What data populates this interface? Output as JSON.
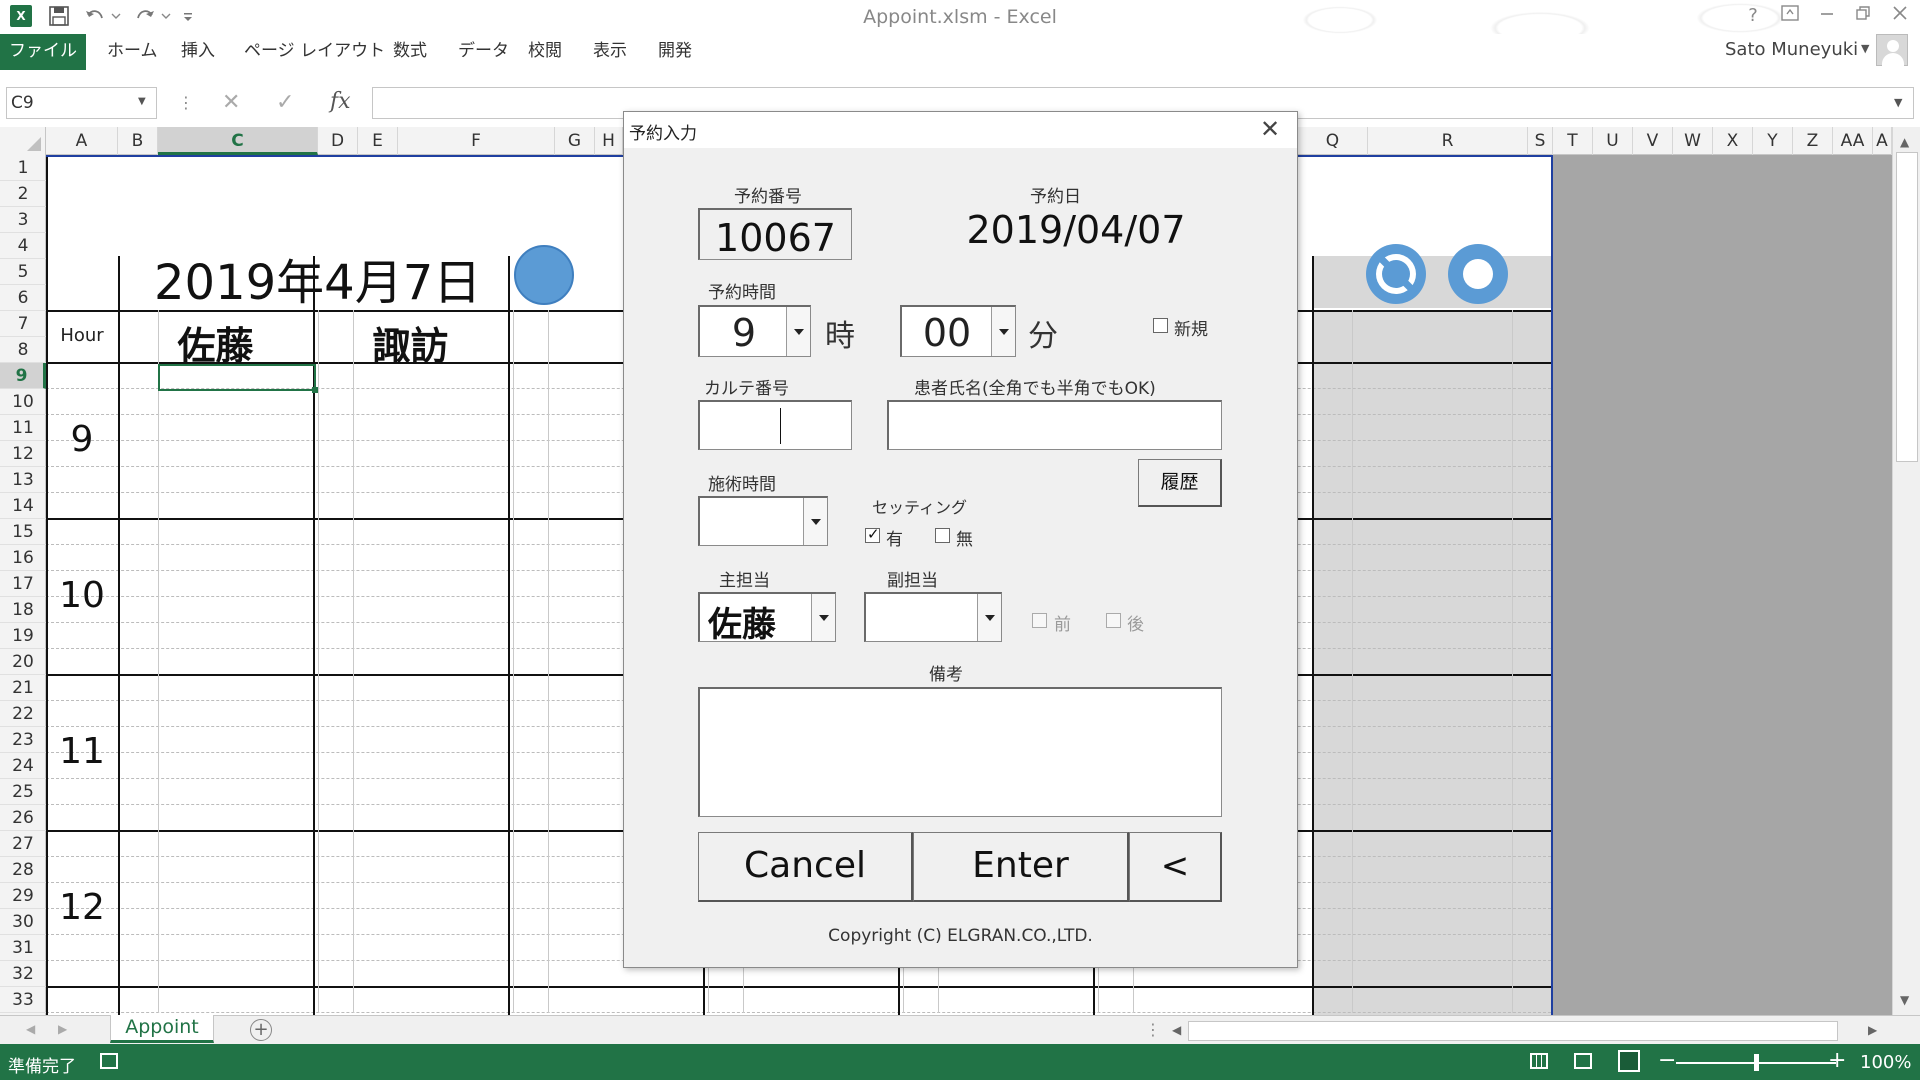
{
  "window": {
    "app_logo": "X",
    "title": "Appoint.xlsm - Excel",
    "user_name": "Sato Muneyuki"
  },
  "ribbon": {
    "tabs": [
      "ファイル",
      "ホーム",
      "挿入",
      "ページ レイアウト",
      "数式",
      "データ",
      "校閲",
      "表示",
      "開発"
    ]
  },
  "formula_bar": {
    "name_box": "C9",
    "formula": ""
  },
  "grid": {
    "columns": [
      "A",
      "B",
      "C",
      "D",
      "E",
      "F",
      "G",
      "H",
      "Q",
      "R",
      "S",
      "T",
      "U",
      "V",
      "W",
      "X",
      "Y",
      "Z",
      "AA",
      "A"
    ],
    "selected_column": "C",
    "rows": [
      "1",
      "2",
      "3",
      "4",
      "5",
      "6",
      "7",
      "8",
      "9",
      "10",
      "11",
      "12",
      "13",
      "14",
      "15",
      "16",
      "17",
      "18",
      "19",
      "20",
      "21",
      "22",
      "23",
      "24",
      "25",
      "26",
      "27",
      "28",
      "29",
      "30",
      "31",
      "32",
      "33"
    ],
    "selected_row": "9"
  },
  "sheet": {
    "date_heading": "2019年4月7日",
    "hour_header": "Hour",
    "staff": [
      "佐藤",
      "諏訪"
    ],
    "hours": [
      "9",
      "10",
      "11",
      "12"
    ]
  },
  "sheet_tabs": {
    "active": "Appoint"
  },
  "status": {
    "text": "準備完了",
    "zoom": "100%",
    "zoom_fraction": 0.5
  },
  "dialog": {
    "title": "予約入力",
    "appointment_number_label": "予約番号",
    "appointment_number": "10067",
    "appointment_date_label": "予約日",
    "appointment_date": "2019/04/07",
    "appointment_time_label": "予約時間",
    "hour_value": "9",
    "hour_unit": "時",
    "minute_value": "00",
    "minute_unit": "分",
    "new_label": "新規",
    "chart_number_label": "カルテ番号",
    "chart_number": "",
    "patient_name_label": "患者氏名(全角でも半角でもOK)",
    "patient_name": "",
    "history_button": "履歴",
    "treatment_time_label": "施術時間",
    "treatment_time": "",
    "setting_label": "セッティング",
    "setting_yes": "有",
    "setting_no": "無",
    "main_staff_label": "主担当",
    "main_staff": "佐藤",
    "sub_staff_label": "副担当",
    "sub_staff": "",
    "before_label": "前",
    "after_label": "後",
    "remarks_label": "備考",
    "remarks": "",
    "cancel_button": "Cancel",
    "enter_button": "Enter",
    "back_button": "<",
    "copyright": "Copyright (C)  ELGRAN.CO.,LTD."
  },
  "colors": {
    "excel_green": "#217346",
    "accent_blue": "#5b9bd5",
    "print_border": "#1f3fa0"
  }
}
